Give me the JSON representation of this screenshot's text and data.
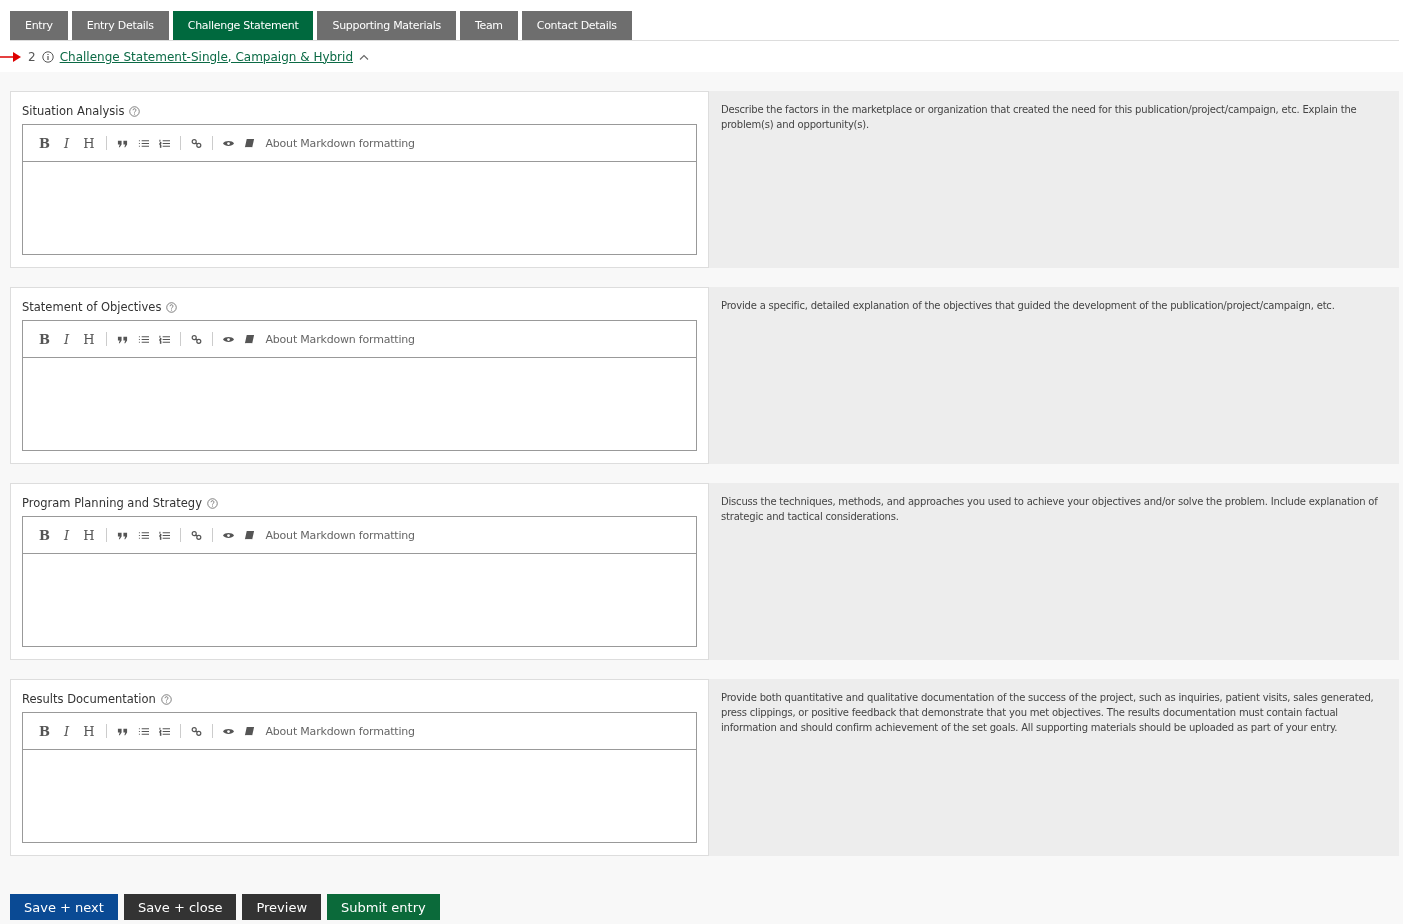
{
  "tabs": [
    {
      "label": "Entry",
      "selected": false
    },
    {
      "label": "Entry Details",
      "selected": false
    },
    {
      "label": "Challenge Statement",
      "selected": true
    },
    {
      "label": "Supporting Materials",
      "selected": false
    },
    {
      "label": "Team",
      "selected": false
    },
    {
      "label": "Contact Details",
      "selected": false
    }
  ],
  "section": {
    "number": "2",
    "title": "Challenge Statement-Single, Campaign & Hybrid",
    "expanded": true
  },
  "fields": [
    {
      "label": "Situation Analysis",
      "toolbar": [
        "B",
        "I",
        "H"
      ],
      "markdown_link": "About Markdown formatting",
      "help": "Describe the factors in the marketplace or organization that created the need for this publication/project/campaign, etc. Explain the problem(s) and opportunity(s)."
    },
    {
      "label": "Statement of Objectives",
      "toolbar": [
        "B",
        "I",
        "H"
      ],
      "markdown_link": "About Markdown formatting",
      "help": "Provide a specific, detailed explanation of the objectives that guided the development of the publication/project/campaign, etc."
    },
    {
      "label": "Program Planning and Strategy",
      "toolbar": [
        "B",
        "I",
        "H"
      ],
      "markdown_link": "About Markdown formatting",
      "help": "Discuss the techniques, methods, and approaches you used to achieve your objectives and/or solve the problem. Include explanation of strategic and tactical considerations."
    },
    {
      "label": "Results Documentation",
      "toolbar": [
        "B",
        "I",
        "H"
      ],
      "markdown_link": "About Markdown formatting",
      "help": "Provide both quantitative and qualitative documentation of the success of the project, such as inquiries, patient visits, sales generated, press clippings, or positive feedback that demonstrate that you met objectives. The results documentation must contain factual information and should confirm achievement of the set goals. All supporting materials should be uploaded as part of your entry."
    }
  ],
  "buttons": [
    {
      "label": "Save + next",
      "kind": "primary"
    },
    {
      "label": "Save + close",
      "kind": "dark"
    },
    {
      "label": "Preview",
      "kind": "dark"
    },
    {
      "label": "Submit entry",
      "kind": "success"
    }
  ]
}
